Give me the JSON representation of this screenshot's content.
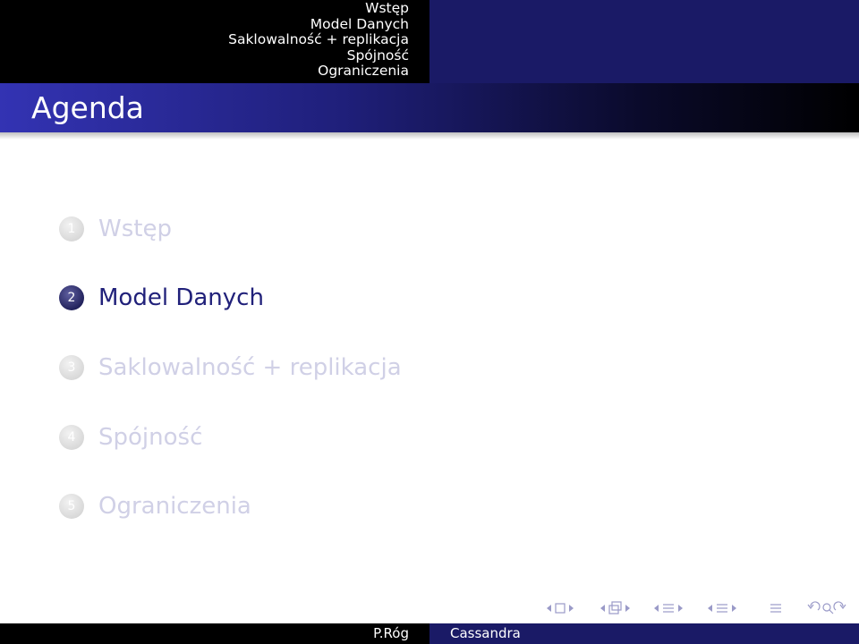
{
  "headline": {
    "sections": [
      "Wstęp",
      "Model Danych",
      "Saklowalność + replikacja",
      "Spójność",
      "Ograniczenia"
    ]
  },
  "frame": {
    "title": "Agenda"
  },
  "toc": {
    "items": [
      {
        "number": "1",
        "label": "Wstęp",
        "state": "shaded"
      },
      {
        "number": "2",
        "label": "Model Danych",
        "state": "active"
      },
      {
        "number": "3",
        "label": "Saklowalność + replikacja",
        "state": "shaded"
      },
      {
        "number": "4",
        "label": "Spójność",
        "state": "shaded"
      },
      {
        "number": "5",
        "label": "Ograniczenia",
        "state": "shaded"
      }
    ]
  },
  "navigation_symbols": {
    "icons": [
      "nav-frame-prev-icon",
      "nav-frame-icon",
      "nav-frame-next-icon",
      "nav-subsection-prev-icon",
      "nav-subsection-icon",
      "nav-subsection-next-icon",
      "nav-section-prev-icon",
      "nav-section-icon",
      "nav-section-next-icon",
      "nav-doc-prev-icon",
      "nav-doc-icon",
      "nav-doc-next-icon",
      "nav-align-icon",
      "nav-back-icon",
      "nav-search-icon",
      "nav-forward-icon"
    ]
  },
  "footer": {
    "author": "P.Róg",
    "title": "Cassandra"
  },
  "colors": {
    "accent": "#21217a",
    "shaded_text": "#d0d0e6",
    "headline_right": "#1a1a66"
  }
}
